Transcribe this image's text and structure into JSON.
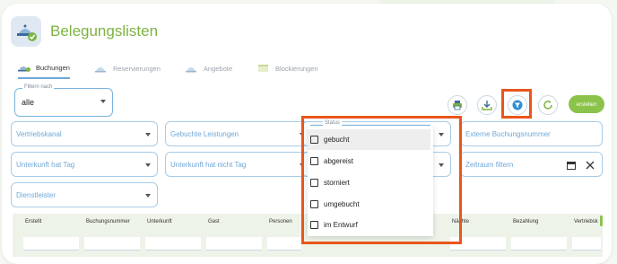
{
  "header": {
    "title": "Belegungslisten"
  },
  "tabs": [
    {
      "label": "Buchungen",
      "active": true
    },
    {
      "label": "Reservierungen",
      "active": false
    },
    {
      "label": "Angebote",
      "active": false
    },
    {
      "label": "Blockierungen",
      "active": false
    }
  ],
  "filter": {
    "legend": "Filtern nach",
    "value": "alle"
  },
  "toolbar": {
    "create_label": "erstellen"
  },
  "filters": {
    "vertriebskanal": "Vertriebskanal",
    "gebuchte_leistungen": "Gebuchte Leistungen",
    "externe_buchungsnummer": "Externe Buchungsnummer",
    "unterkunft_hat_tag": "Unterkunft hat Tag",
    "unterkunft_hat_nicht_tag": "Unterkunft hat nicht Tag",
    "zeitraum_filtern": "Zeitraum filtern",
    "dienstleister": "Dienstleister"
  },
  "status_dropdown": {
    "legend": "Status",
    "options": [
      "gebucht",
      "abgereist",
      "storniert",
      "umgebucht",
      "im Entwurf"
    ]
  },
  "table": {
    "columns": [
      "Erstellt",
      "Buchungsnummer",
      "Unterkunft",
      "Gast",
      "Personen",
      "Nächte",
      "Bezahlung",
      "Vertriebsk"
    ]
  },
  "colors": {
    "accent": "#8bc34a",
    "highlight": "#e8561c",
    "border": "#78b4e0"
  }
}
